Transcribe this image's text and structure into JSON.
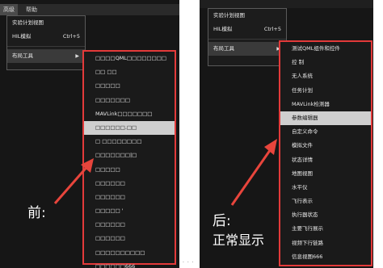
{
  "menubar": {
    "items": [
      "高级",
      "帮助"
    ]
  },
  "main_menu": {
    "item1": "实验计划视图",
    "item2": "HIL模拟",
    "item2_shortcut": "Ctrl+5",
    "layout_tools": "布局工具"
  },
  "left_submenu": [
    "□□□□QML□□□□□□□□",
    "□□  □□",
    "□□□□□",
    "□□□□□□□",
    "MAVLink□□□□□□□",
    "□□□□□□.□□",
    "□  □□□□□□□□",
    "□□□□□□□|□",
    "□□□□□",
    "□□□□□□",
    "□□□□□□",
    "□□□□□  '",
    "□□□□□□",
    "□□□□□□",
    "□□□□□□□□□□",
    "□□□□□□666"
  ],
  "right_submenu": [
    "测试QML组件和控件",
    "控    制",
    "无人系统",
    "任务计划",
    "MAVLink检测器",
    "参数编辑器",
    "自定义命令",
    "模拟文件",
    "状态详情",
    "地图视图",
    "水平仪",
    "飞行表示",
    "执行器状态",
    "主要飞行展示",
    "视频下行链路",
    "信息视图666"
  ],
  "annotations": {
    "before": "前:",
    "after_line1": "后:",
    "after_line2": "正常显示"
  },
  "colors": {
    "highlight_box": "#e33a3a",
    "arrow": "#e8453c"
  }
}
